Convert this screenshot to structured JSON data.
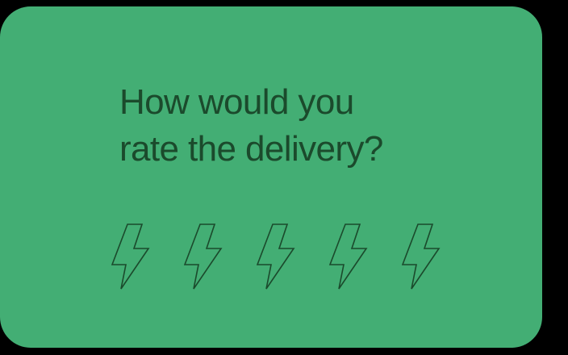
{
  "card": {
    "question_line1": "How would you",
    "question_line2": "rate the delivery?",
    "background_color": "#43ae74",
    "text_color": "#1b4a2c"
  },
  "rating": {
    "icon": "lightning-bolt-icon",
    "max": 5,
    "selected": 0,
    "items": [
      {
        "value": 1
      },
      {
        "value": 2
      },
      {
        "value": 3
      },
      {
        "value": 4
      },
      {
        "value": 5
      }
    ]
  }
}
